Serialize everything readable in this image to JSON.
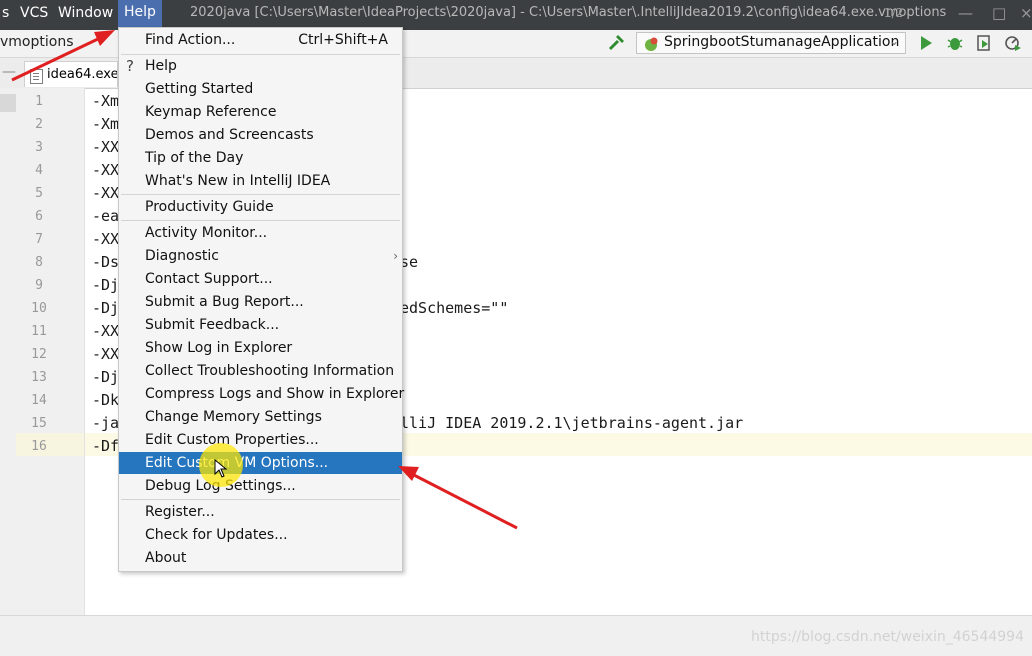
{
  "titlebar": {
    "menu_s": "s",
    "menu_vcs": "VCS",
    "menu_window": "Window",
    "menu_help": "Help",
    "title": "2020java [C:\\Users\\Master\\IdeaProjects\\2020java] - C:\\Users\\Master\\.IntelliJIdea2019.2\\config\\idea64.exe.vmoptions",
    "page_badge": "1/2"
  },
  "navbar": {
    "breadcrumb": "vmoptions",
    "run_config": "SpringbootStumanageApplication"
  },
  "tabs": {
    "file_tab": "idea64.exe.vmoptions"
  },
  "editor": {
    "line_numbers": [
      "1",
      "2",
      "3",
      "4",
      "5",
      "6",
      "7",
      "8",
      "9",
      "10",
      "11",
      "12",
      "13",
      "14",
      "15",
      "16"
    ],
    "lines": [
      "-Xm",
      "-Xm",
      "-XX",
      "-XX",
      "-XX",
      "-ea",
      "-XX",
      "-Ds",
      "-Dj",
      "-Dj",
      "-XX",
      "-XX",
      "-Dj",
      "-Dk",
      "-ja",
      "-Df"
    ],
    "line8_tail": "se",
    "line10_tail": "edSchemes=\"\"",
    "line15_tail": "lliJ IDEA 2019.2.1\\jetbrains-agent.jar"
  },
  "help_menu": {
    "find_action": "Find Action...",
    "find_action_shortcut": "Ctrl+Shift+A",
    "help_glyph": "?",
    "help": "Help",
    "getting_started": "Getting Started",
    "keymap_reference": "Keymap Reference",
    "demos_and_screencasts": "Demos and Screencasts",
    "tip_of_the_day": "Tip of the Day",
    "whats_new": "What's New in IntelliJ IDEA",
    "productivity_guide": "Productivity Guide",
    "activity_monitor": "Activity Monitor...",
    "diagnostic": "Diagnostic",
    "contact_support": "Contact Support...",
    "submit_bug_report": "Submit a Bug Report...",
    "submit_feedback": "Submit Feedback...",
    "show_log_in_explorer": "Show Log in Explorer",
    "collect_troubleshooting": "Collect Troubleshooting Information",
    "compress_logs": "Compress Logs and Show in Explorer",
    "change_memory_settings": "Change Memory Settings",
    "edit_custom_properties": "Edit Custom Properties...",
    "edit_custom_vm_options": "Edit Custom VM Options...",
    "debug_log_settings": "Debug Log Settings...",
    "register": "Register...",
    "check_for_updates": "Check for Updates...",
    "about": "About"
  },
  "footer": {
    "watermark": "https://blog.csdn.net/weixin_46544994"
  },
  "colors": {
    "menu_highlight": "#2675bf",
    "annotation_arrow": "#e02020",
    "cursor_highlight": "#ffe800",
    "titlebar_bg": "#3c3f41"
  }
}
